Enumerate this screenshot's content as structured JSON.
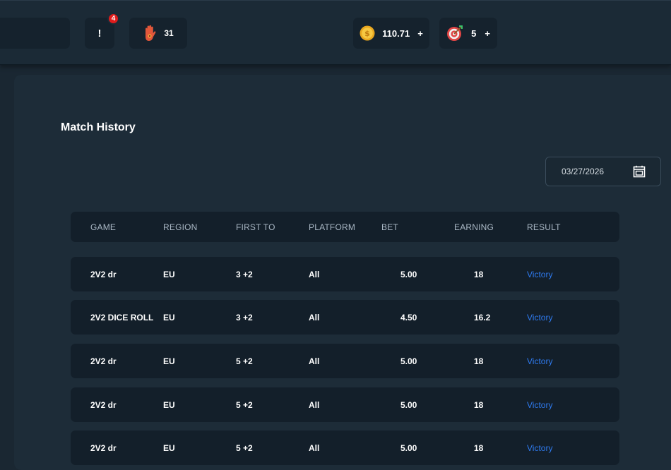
{
  "header": {
    "notifications": {
      "label": "!",
      "count": "4"
    },
    "hand_counter": {
      "value": "31",
      "icon": "hand-icon"
    },
    "coins": {
      "value": "110.71",
      "plus": "+",
      "icon": "coin-icon"
    },
    "targets": {
      "value": "5",
      "plus": "+",
      "icon": "target-icon"
    }
  },
  "main": {
    "title": "Match History",
    "date_filter": {
      "value": "03/27/2026",
      "icon": "calendar-icon"
    },
    "table": {
      "columns": [
        "GAME",
        "REGION",
        "FIRST TO",
        "PLATFORM",
        "BET",
        "EARNING",
        "RESULT"
      ],
      "rows": [
        {
          "game": "2V2 dr",
          "region": "EU",
          "first_to": "3 +2",
          "platform": "All",
          "bet": "5.00",
          "earning": "18",
          "result": "Victory"
        },
        {
          "game": "2V2 DICE ROLL",
          "region": "EU",
          "first_to": "3 +2",
          "platform": "All",
          "bet": "4.50",
          "earning": "16.2",
          "result": "Victory"
        },
        {
          "game": "2V2 dr",
          "region": "EU",
          "first_to": "5 +2",
          "platform": "All",
          "bet": "5.00",
          "earning": "18",
          "result": "Victory"
        },
        {
          "game": "2V2 dr",
          "region": "EU",
          "first_to": "5 +2",
          "platform": "All",
          "bet": "5.00",
          "earning": "18",
          "result": "Victory"
        },
        {
          "game": "2V2 dr",
          "region": "EU",
          "first_to": "5 +2",
          "platform": "All",
          "bet": "5.00",
          "earning": "18",
          "result": "Victory"
        }
      ]
    }
  },
  "colors": {
    "background": "#1a2732",
    "panel": "#1d2c38",
    "row": "#131f2a",
    "victory": "#2f7bf0",
    "badge": "#e01c1c"
  }
}
